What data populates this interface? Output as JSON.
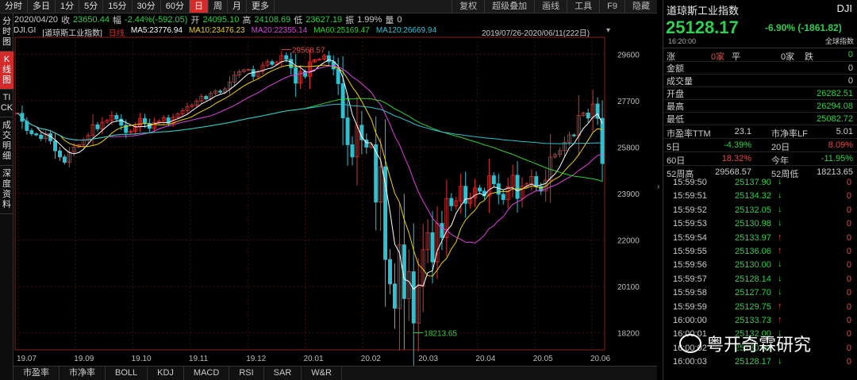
{
  "timeframes": [
    "分时",
    "多日",
    "1分",
    "5分",
    "15分",
    "30分",
    "60分",
    "日",
    "周",
    "月",
    "更多"
  ],
  "active_timeframe": "日",
  "tools": [
    "复权",
    "超级叠加",
    "画线",
    "工具",
    "F9",
    "隐藏"
  ],
  "info": {
    "date": "2020/04/20",
    "close_label": "收",
    "close": "23650.44",
    "amp_label": "幅",
    "amp": "-2.44%(-592.05)",
    "open_label": "开",
    "open": "24095.10",
    "high_label": "高",
    "high": "24108.69",
    "low_label": "低",
    "low": "23627.19",
    "swing_label": "振",
    "swing": "1.99%",
    "volume_label": "量",
    "volume": "0"
  },
  "sidebar_tabs": [
    "分时图",
    "K线图",
    "TICK",
    "成交明细",
    "深度资料"
  ],
  "active_side": "K线图",
  "legend": {
    "code": "DJI.GI",
    "name": "[道琼斯工业指数]",
    "period": "日线",
    "ma5": "MA5:23776.94",
    "ma10": "MA10:23476.23",
    "ma20": "MA20:22355.14",
    "ma60": "MA60:25169.47",
    "ma120": "MA120:26669.94",
    "range": "2019/07/26-2020/06/11(222日)"
  },
  "colors": {
    "ma5": "#ffffff",
    "ma10": "#f0d000",
    "ma20": "#e040e0",
    "ma60": "#30d030",
    "ma120": "#30c0d0",
    "up": "#e03030",
    "down": "#30c0d0"
  },
  "chart_data": {
    "type": "candlestick",
    "ylim": [
      17500,
      30300
    ],
    "y_ticks": [
      29600,
      27700,
      25800,
      23900,
      22000,
      20100,
      18200
    ],
    "x_ticks": [
      "19.07",
      "19.09",
      "19.10",
      "19.11",
      "19.12",
      "20.01",
      "20.02",
      "20.03",
      "20.04",
      "20.05",
      "20.06"
    ],
    "annotations": {
      "max_label": "29568.57",
      "min_label": "18213.65"
    },
    "series_close": [
      27190,
      26860,
      26480,
      26350,
      26300,
      26150,
      26360,
      26060,
      25650,
      25400,
      25180,
      25600,
      25800,
      25900,
      26100,
      26280,
      26720,
      26550,
      26820,
      26900,
      27100,
      26950,
      26700,
      26400,
      26450,
      26650,
      26970,
      26780,
      26570,
      26820,
      26860,
      27000,
      26780,
      27020,
      27160,
      27300,
      27460,
      27520,
      27680,
      27880,
      27780,
      28000,
      28100,
      28050,
      28190,
      28460,
      28750,
      28890,
      28970,
      28980,
      28700,
      28900,
      29160,
      29300,
      29190,
      29290,
      29550,
      29400,
      29050,
      28420,
      28900,
      28700,
      29290,
      29380,
      29400,
      29550,
      29300,
      29000,
      28400,
      27000,
      25900,
      25400,
      26700,
      26100,
      25800,
      25900,
      23550,
      25000,
      21200,
      20200,
      19200,
      21800,
      19600,
      20700,
      18600,
      20100,
      21600,
      22300,
      21100,
      22680,
      22100,
      23700,
      23400,
      23600,
      24200,
      23500,
      23720,
      24130,
      24000,
      23800,
      24630,
      24300,
      23870,
      23650,
      24180,
      24650,
      23700,
      24200,
      24300,
      24600,
      24200,
      24000,
      24450,
      25400,
      25500,
      25660,
      26000,
      26300,
      26270,
      27100,
      27200,
      26990,
      27570,
      26980,
      25128
    ]
  },
  "right_panel": {
    "title": "道琼斯工业指数",
    "code": "DJI",
    "price": "25128.17",
    "change": "-6.90% (-1861.82)",
    "time": "16:20:00",
    "global_label": "全球指数",
    "breadth": {
      "up_label": "涨",
      "up": "0家",
      "flat_label": "平",
      "flat": "0家",
      "down_label": "跌",
      "down": "0"
    },
    "rows": [
      {
        "label": "金额",
        "value": "0"
      },
      {
        "label": "成交量",
        "value": "0"
      },
      {
        "label": "开盘",
        "value": "26282.51"
      },
      {
        "label": "最高",
        "value": "26294.08"
      },
      {
        "label": "最低",
        "value": "25082.72"
      }
    ],
    "stats": [
      {
        "l1": "市盈率TTM",
        "v1": "23.1",
        "l2": "市净率LF",
        "v2": "5.01"
      },
      {
        "l1": "5日",
        "v1": "-4.39%",
        "l2": "20日",
        "v2": "8.09%"
      },
      {
        "l1": "60日",
        "v1": "18.32%",
        "l2": "今年",
        "v2": "-11.95%"
      },
      {
        "l1": "52周高",
        "v1": "29568.57",
        "l2": "52周低",
        "v2": "18213.65"
      }
    ],
    "ticks": [
      {
        "t": "15:59:50",
        "p": "25137.90",
        "d": "dn",
        "v": "0"
      },
      {
        "t": "15:59:51",
        "p": "25134.32",
        "d": "dn",
        "v": "0"
      },
      {
        "t": "15:59:52",
        "p": "25132.05",
        "d": "dn",
        "v": "0"
      },
      {
        "t": "15:59:53",
        "p": "25130.98",
        "d": "dn",
        "v": "0"
      },
      {
        "t": "15:59:54",
        "p": "25133.97",
        "d": "up",
        "v": "0"
      },
      {
        "t": "15:59:55",
        "p": "25136.06",
        "d": "up",
        "v": "0"
      },
      {
        "t": "15:59:56",
        "p": "25130.00",
        "d": "dn",
        "v": "0"
      },
      {
        "t": "15:59:57",
        "p": "25128.14",
        "d": "dn",
        "v": "0"
      },
      {
        "t": "15:59:58",
        "p": "25127.70",
        "d": "dn",
        "v": "0"
      },
      {
        "t": "15:59:59",
        "p": "25129.75",
        "d": "up",
        "v": "0"
      },
      {
        "t": "16:00:00",
        "p": "25133.73",
        "d": "up",
        "v": "0"
      },
      {
        "t": "16:00:01",
        "p": "25132.00",
        "d": "dn",
        "v": "0"
      },
      {
        "t": "16:00:02",
        "p": "25130.00",
        "d": "dn",
        "v": "0"
      },
      {
        "t": "16:00:03",
        "p": "25128.17",
        "d": "dn",
        "v": "0"
      }
    ]
  },
  "indicators": [
    "市盈率",
    "市净率",
    "BOLL",
    "KDJ",
    "MACD",
    "RSI",
    "SAR",
    "W&R"
  ],
  "watermark": "粤开奇霖研究"
}
